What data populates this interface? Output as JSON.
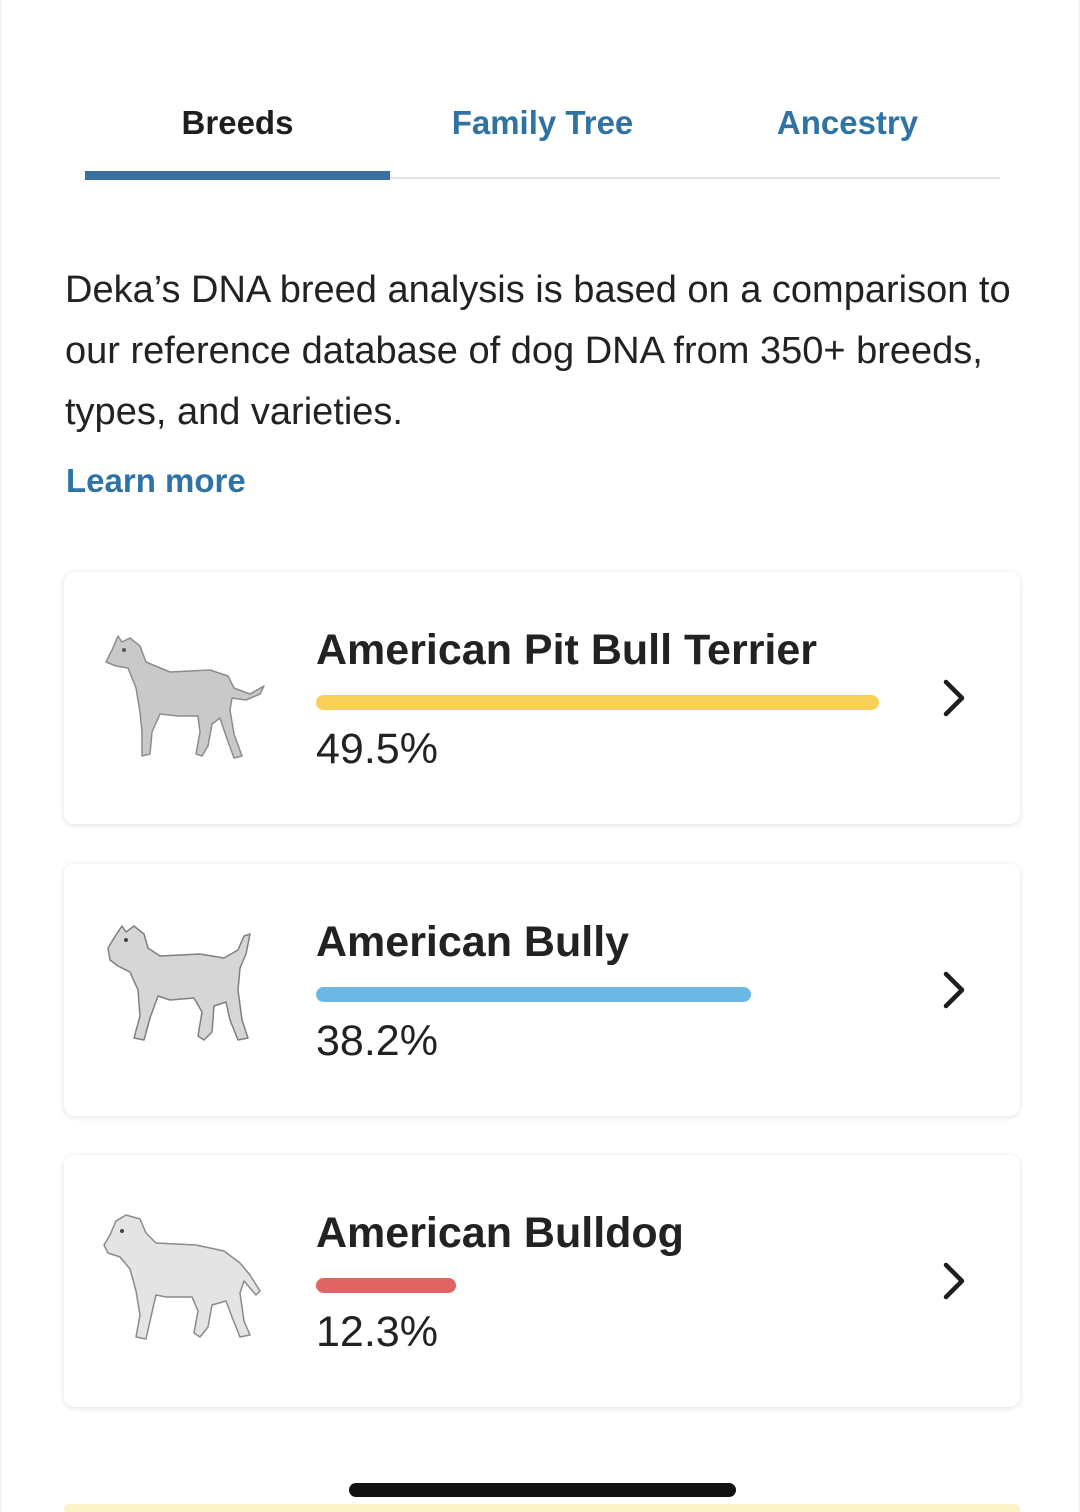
{
  "tabs": [
    {
      "label": "Breeds",
      "active": true
    },
    {
      "label": "Family Tree",
      "active": false
    },
    {
      "label": "Ancestry",
      "active": false
    }
  ],
  "description": "Deka’s DNA breed analysis is based on a comparison to our reference database of dog DNA from 350+ breeds, types, and varieties.",
  "learn_more": "Learn more",
  "breeds": [
    {
      "name": "American Pit Bull Terrier",
      "percent_label": "49.5%",
      "percent": 49.5,
      "color": "#f8d058",
      "icon": "pit-bull-image"
    },
    {
      "name": "American Bully",
      "percent_label": "38.2%",
      "percent": 38.2,
      "color": "#6bb8e4",
      "icon": "bully-image"
    },
    {
      "name": "American Bulldog",
      "percent_label": "12.3%",
      "percent": 12.3,
      "color": "#e06464",
      "icon": "bulldog-image"
    }
  ],
  "colors": {
    "accent": "#2f73a4",
    "tab_indicator": "#3a6f9f",
    "text": "#222222"
  }
}
